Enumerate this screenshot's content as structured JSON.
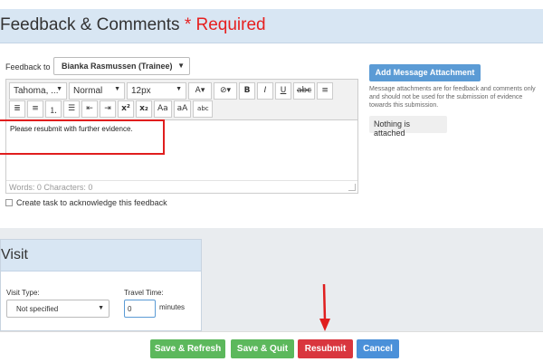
{
  "feedback": {
    "title": "Feedback & Comments",
    "required": "* Required",
    "feedback_to_label": "Feedback to",
    "feedback_to_value": "Bianka Rasmussen (Trainee)",
    "toolbar": {
      "font": "Tahoma, ...",
      "style": "Normal",
      "size": "12px",
      "font_color": "A",
      "bold": "B",
      "italic": "I",
      "underline": "U",
      "strikethrough": "abc",
      "superscript": "x²",
      "subscript": "x₂",
      "case_a": "Aa",
      "case_b": "aA",
      "spellcheck": "abc"
    },
    "editor_text": "Please resubmit with further evidence.",
    "word_count": "Words: 0   Characters: 0",
    "task_label": "Create task to acknowledge this feedback",
    "attach_button": "Add Message Attachment",
    "attach_note": "Message attachments are for feedback and comments only and should not be used for the submission of evidence towards this submission.",
    "nothing_attached": "Nothing is attached"
  },
  "visit": {
    "title": "Visit",
    "visit_type_label": "Visit Type:",
    "visit_type_value": "Not specified",
    "travel_time_label": "Travel Time:",
    "travel_time_value": "0",
    "travel_time_unit": "minutes"
  },
  "footer": {
    "save_refresh": "Save & Refresh",
    "save_quit": "Save & Quit",
    "resubmit": "Resubmit",
    "cancel": "Cancel"
  },
  "colors": {
    "header_bg": "#d8e6f3",
    "required": "#e62020",
    "primary_blue": "#5b9bd5",
    "success_green": "#5cb85c",
    "danger_red": "#d9363e",
    "annotation_red": "#e01e1e"
  }
}
